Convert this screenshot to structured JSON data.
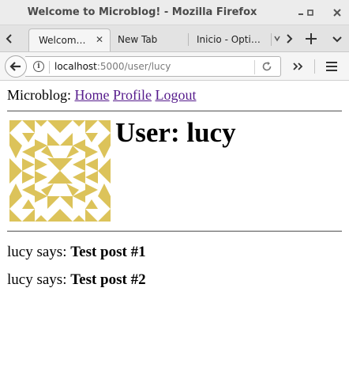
{
  "window": {
    "title": "Welcome to Microblog! - Mozilla Firefox",
    "minimize_icon": "minimize-icon",
    "maximize_icon": "maximize-icon",
    "close_icon": "close-icon"
  },
  "tabs": [
    {
      "label": "Welcom…",
      "active": true
    },
    {
      "label": "New Tab",
      "active": false
    },
    {
      "label": "Inicio - Opti…",
      "active": false
    }
  ],
  "toolbar": {
    "new_tab_icon": "plus-icon",
    "tab_list_icon": "chevron-down-icon"
  },
  "urlbar": {
    "host": "localhost",
    "path": ":5000/user/lucy"
  },
  "page": {
    "brand": "Microblog:",
    "links": [
      "Home",
      "Profile",
      "Logout"
    ],
    "user_heading": "User: lucy",
    "avatar_color": "#dcc35a",
    "posts": [
      {
        "author": "lucy",
        "says": "says:",
        "body": "Test post #1"
      },
      {
        "author": "lucy",
        "says": "says:",
        "body": "Test post #2"
      }
    ]
  }
}
